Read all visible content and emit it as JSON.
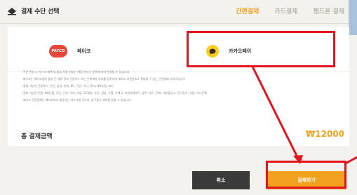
{
  "header": {
    "title": "결제 수단 선택",
    "tabs": [
      {
        "label": "간편결제",
        "active": true
      },
      {
        "label": "카드결제",
        "active": false
      },
      {
        "label": "핸드폰 결제",
        "active": false
      }
    ]
  },
  "methods": [
    {
      "name": "페이코",
      "logo_text": "PAYCO"
    },
    {
      "name": "카카오페이",
      "logo_text": ""
    }
  ],
  "notes": [
    "- 주문 변경 시 카드사 혜택 및 할부 적용 여부는 해당 카드사 정책에 따라 변경될 수 있습니다.",
    "- 페이코는 페이코앱에 활성 된 계정 정보 신용카드 또는 은행계좌 정보를 등록하여 페이코 비밀번호로 결제할 수 있는 간편결제 서비스입니다.",
    "- 결제 가능한 신용카드: 신한, 삼성, 현대, BC, 국민, 하나, 롯데, NH농협, 씨티",
    "- 결제 가능한 은행: NH농협, 국민, 신한, 우리, 기업, SC제일, 부산, 경남, 수협, 우체국, 미래에셋대우, 광주, 대구, 전북, 새마을금고, 한국투자, 신협, 하나은행",
    "- 페이코 간편결제는 페이코에서 제공하는 카드사별 무이자, 청구할인 혜택을 받을 수 있습니다."
  ],
  "total": {
    "label": "총 결제금액",
    "value": "₩12000"
  },
  "buttons": {
    "cancel": "취소",
    "pay": "결제하기"
  },
  "colors": {
    "accent": "#f2a11e",
    "highlight": "#e3141e",
    "payco": "#e8463a",
    "kakao": "#fbcd1e"
  }
}
